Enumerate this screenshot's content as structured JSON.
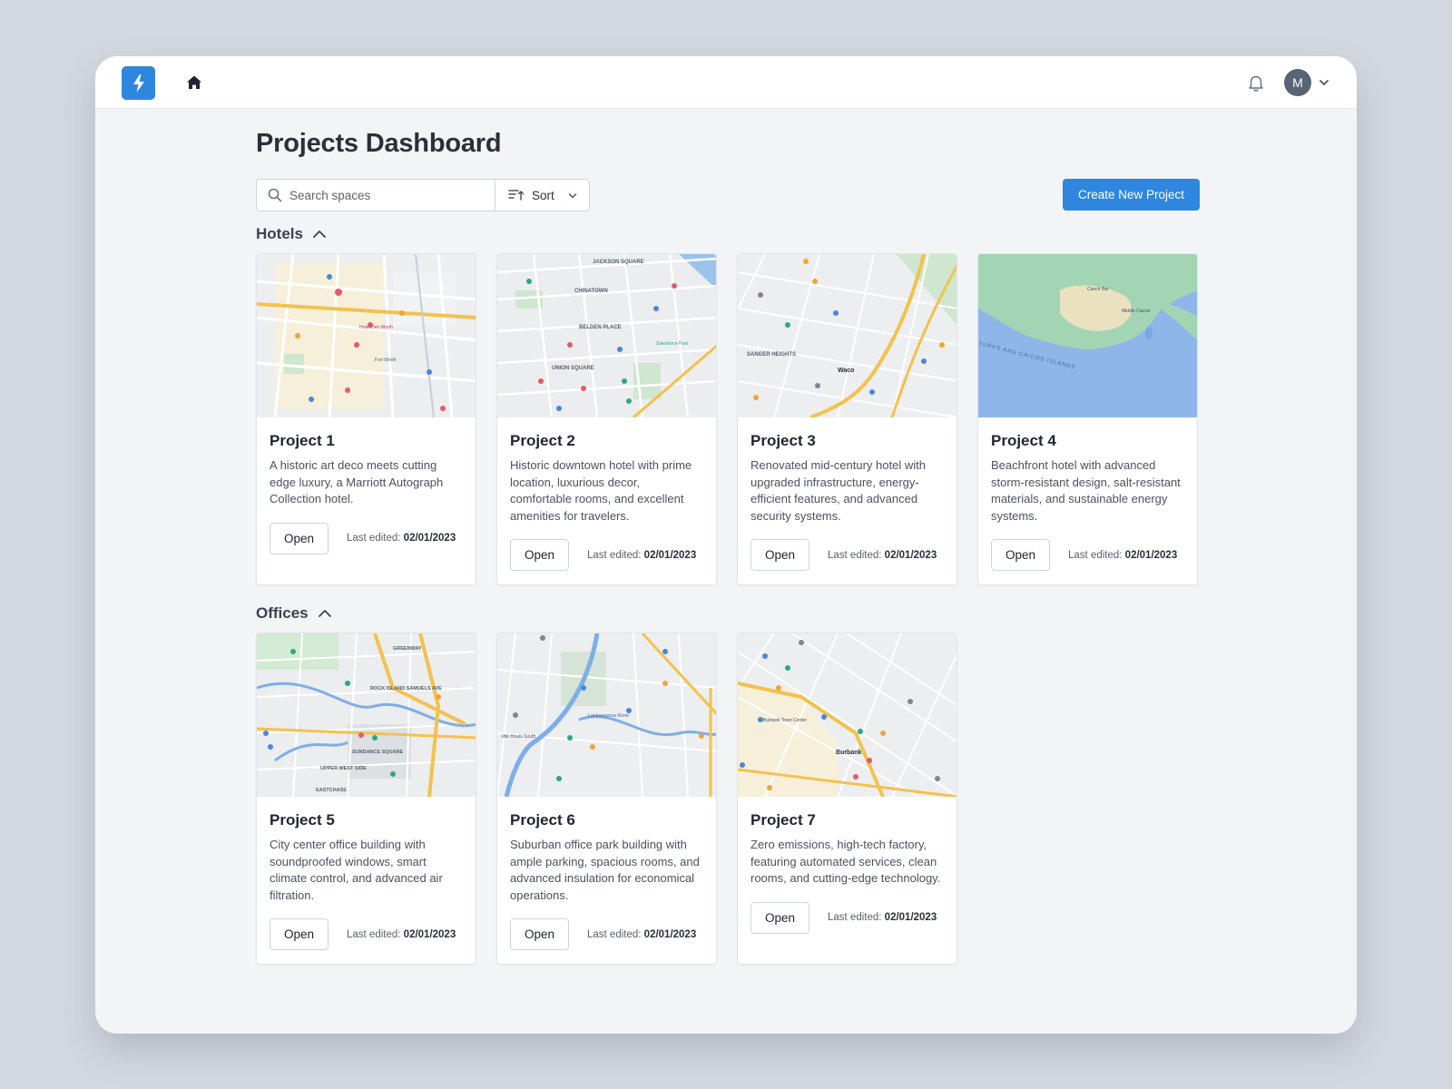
{
  "topbar": {
    "logo_icon": "bolt-icon",
    "home_icon": "home-icon",
    "bell_icon": "bell-icon",
    "avatar_initial": "M",
    "accent": "#2f86de"
  },
  "page": {
    "title": "Projects Dashboard"
  },
  "toolbar": {
    "search_placeholder": "Search spaces",
    "sort_label": "Sort",
    "create_label": "Create New Project"
  },
  "sections": [
    {
      "title": "Hotels",
      "projects": [
        {
          "name": "Project 1",
          "description": "A historic art deco meets cutting edge luxury, a Marriott Autograph Collection hotel.",
          "open_label": "Open",
          "edited_label": "Last edited:",
          "edited_date": "02/01/2023"
        },
        {
          "name": "Project 2",
          "description": "Historic downtown hotel with prime location, luxurious decor, comfortable rooms, and excellent amenities for travelers.",
          "open_label": "Open",
          "edited_label": "Last edited:",
          "edited_date": "02/01/2023"
        },
        {
          "name": "Project 3",
          "description": "Renovated mid-century hotel with upgraded infrastructure, energy-efficient features, and advanced security systems.",
          "open_label": "Open",
          "edited_label": "Last edited:",
          "edited_date": "02/01/2023"
        },
        {
          "name": "Project 4",
          "description": "Beachfront hotel with advanced storm-resistant design, salt-resistant materials, and sustainable energy systems.",
          "open_label": "Open",
          "edited_label": "Last edited:",
          "edited_date": "02/01/2023"
        }
      ]
    },
    {
      "title": "Offices",
      "projects": [
        {
          "name": "Project 5",
          "description": "City center office building with soundproofed windows, smart climate control, and advanced air filtration.",
          "open_label": "Open",
          "edited_label": "Last edited:",
          "edited_date": "02/01/2023"
        },
        {
          "name": "Project 6",
          "description": "Suburban office park building with ample parking, spacious rooms, and advanced insulation for economical operations.",
          "open_label": "Open",
          "edited_label": "Last edited:",
          "edited_date": "02/01/2023"
        },
        {
          "name": "Project 7",
          "description": "Zero emissions, high-tech factory, featuring automated services, clean rooms, and cutting-edge technology.",
          "open_label": "Open",
          "edited_label": "Last edited:",
          "edited_date": "02/01/2023"
        }
      ]
    }
  ],
  "maps": {
    "p1": [
      "Hotel Den Worth",
      "Fort Worth"
    ],
    "p2": [
      "JACKSON SQUARE",
      "CHINATOWN",
      "BELDEN PLACE",
      "UNION SQUARE",
      "Salesforce Park"
    ],
    "p3": [
      "SANGER HEIGHTS",
      "Waco"
    ],
    "p4": [
      "TURKS AND CAICOS ISLANDS",
      "Conch Bar",
      "Middle Caicos"
    ],
    "p5": [
      "GREENWAY",
      "ROCK ISLAND SAMUELS AVE",
      "SUNDANCE SQUARE",
      "UPPER WEST SIDE",
      "EASTCHASE"
    ],
    "p6": [
      "Lackawanna River",
      "Idle Hours South"
    ],
    "p7": [
      "Burbank",
      "Burbank Town Center"
    ]
  }
}
